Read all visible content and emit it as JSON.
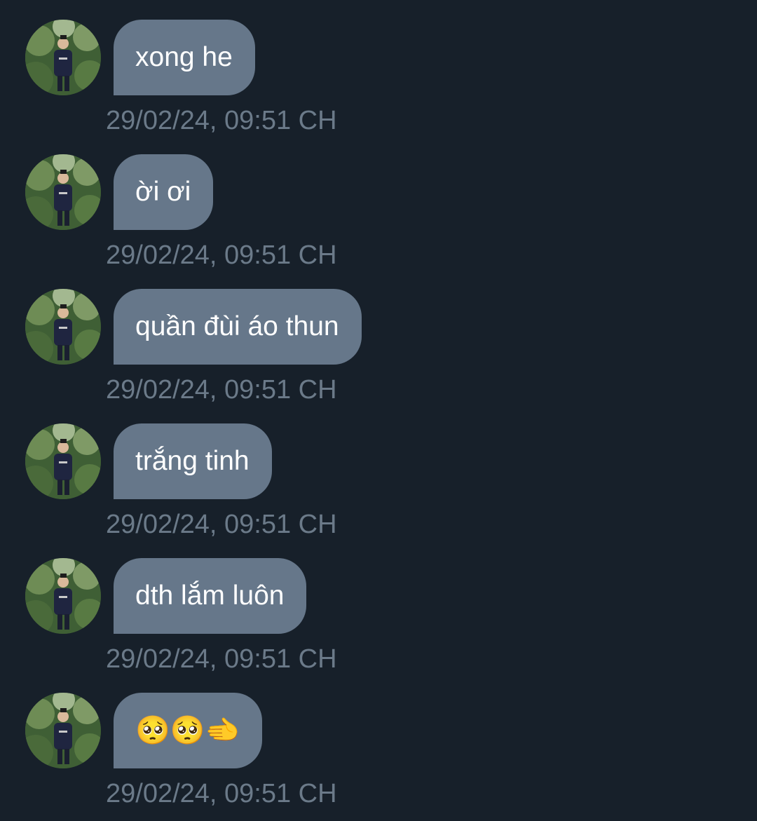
{
  "messages": [
    {
      "text": "xong he",
      "time": "29/02/24, 09:51 CH"
    },
    {
      "text": "ời ơi",
      "time": "29/02/24, 09:51 CH"
    },
    {
      "text": "quần đùi áo thun",
      "time": "29/02/24, 09:51 CH"
    },
    {
      "text": "trắng tinh",
      "time": "29/02/24, 09:51 CH"
    },
    {
      "text": "dth lắm luôn",
      "time": "29/02/24, 09:51 CH"
    },
    {
      "text": "🥺🥺🫲",
      "time": "29/02/24, 09:51 CH"
    }
  ],
  "colors": {
    "background": "#17202a",
    "bubble": "#66778a",
    "bubble_text": "#ffffff",
    "timestamp": "#6b7a89"
  },
  "icons": {
    "avatar": "user-photo-avatar"
  }
}
